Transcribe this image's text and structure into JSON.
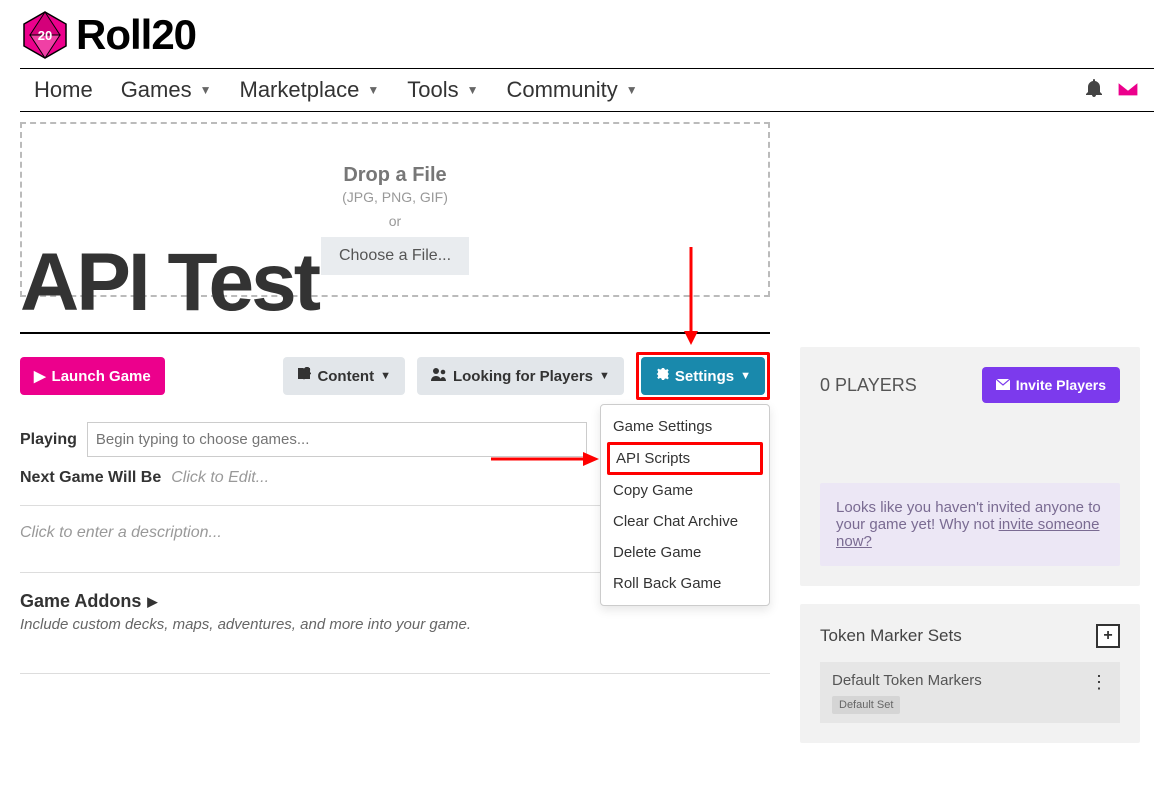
{
  "brand": {
    "name": "Roll20",
    "die_number": "20"
  },
  "nav": {
    "items": [
      "Home",
      "Games",
      "Marketplace",
      "Tools",
      "Community"
    ]
  },
  "dropzone": {
    "title": "Drop a File",
    "subtitle": "(JPG, PNG, GIF)",
    "or": "or",
    "choose": "Choose a File..."
  },
  "game": {
    "title": "API Test"
  },
  "buttons": {
    "launch": "Launch Game",
    "content": "Content",
    "looking": "Looking for Players",
    "settings": "Settings"
  },
  "settings_menu": {
    "items": [
      "Game Settings",
      "API Scripts",
      "Copy Game",
      "Clear Chat Archive",
      "Delete Game",
      "Roll Back Game"
    ]
  },
  "playing": {
    "label": "Playing",
    "placeholder": "Begin typing to choose games..."
  },
  "next_game": {
    "label": "Next Game Will Be",
    "placeholder": "Click to Edit..."
  },
  "description": {
    "placeholder": "Click to enter a description..."
  },
  "addons": {
    "title": "Game Addons",
    "subtitle": "Include custom decks, maps, adventures, and more into your game."
  },
  "side": {
    "players_count": "0 PLAYERS",
    "invite_button": "Invite Players",
    "invite_text_a": "Looks like you haven't invited anyone to your game yet! Why not ",
    "invite_link": "invite someone now?",
    "tms_title": "Token Marker Sets",
    "tms_item_title": "Default Token Markers",
    "tms_badge": "Default Set"
  }
}
